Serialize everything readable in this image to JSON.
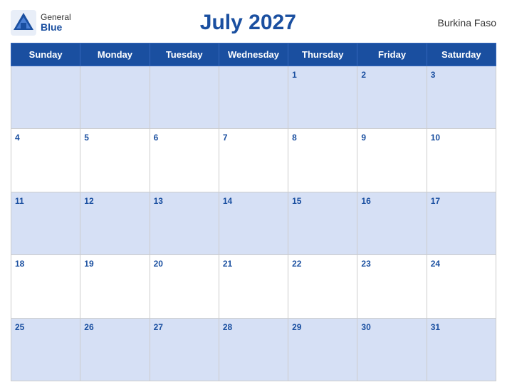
{
  "header": {
    "logo_general": "General",
    "logo_blue": "Blue",
    "title": "July 2027",
    "country": "Burkina Faso"
  },
  "calendar": {
    "days_of_week": [
      "Sunday",
      "Monday",
      "Tuesday",
      "Wednesday",
      "Thursday",
      "Friday",
      "Saturday"
    ],
    "weeks": [
      [
        null,
        null,
        null,
        null,
        1,
        2,
        3
      ],
      [
        4,
        5,
        6,
        7,
        8,
        9,
        10
      ],
      [
        11,
        12,
        13,
        14,
        15,
        16,
        17
      ],
      [
        18,
        19,
        20,
        21,
        22,
        23,
        24
      ],
      [
        25,
        26,
        27,
        28,
        29,
        30,
        31
      ]
    ]
  }
}
